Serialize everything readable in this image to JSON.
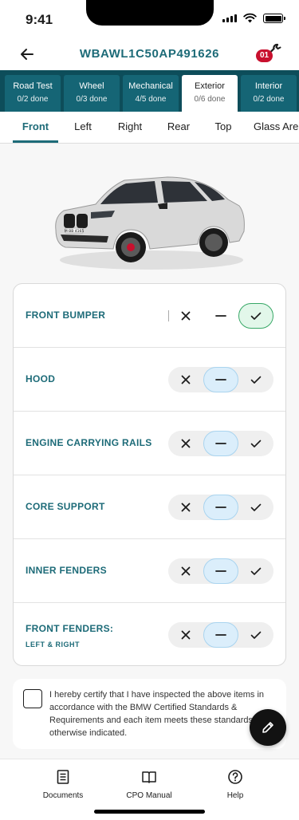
{
  "status_bar": {
    "time": "9:41"
  },
  "header": {
    "title": "WBAWL1C50AP491626",
    "badge_count": "01",
    "back_icon": "arrow-left-icon",
    "tool_icon": "wrench-icon"
  },
  "category_tabs": [
    {
      "name": "Road Test",
      "count": "0/2 done",
      "active": false
    },
    {
      "name": "Wheel",
      "count": "0/3 done",
      "active": false
    },
    {
      "name": "Mechanical",
      "count": "4/5 done",
      "active": false
    },
    {
      "name": "Exterior",
      "count": "0/6 done",
      "active": true
    },
    {
      "name": "Interior",
      "count": "0/2 done",
      "active": false
    }
  ],
  "sub_tabs": [
    {
      "label": "Front",
      "active": true
    },
    {
      "label": "Left",
      "active": false
    },
    {
      "label": "Right",
      "active": false
    },
    {
      "label": "Rear",
      "active": false
    },
    {
      "label": "Top",
      "active": false
    },
    {
      "label": "Glass Area",
      "active": false
    }
  ],
  "vehicle_image": {
    "plate_text": "M BB 4165",
    "color": "#d9d9d9"
  },
  "inspection_items": [
    {
      "label": "FRONT BUMPER",
      "sublabel": "",
      "selected": "pass"
    },
    {
      "label": "HOOD",
      "sublabel": "",
      "selected": "na"
    },
    {
      "label": "ENGINE CARRYING RAILS",
      "sublabel": "",
      "selected": "na"
    },
    {
      "label": "CORE SUPPORT",
      "sublabel": "",
      "selected": "na"
    },
    {
      "label": "INNER FENDERS",
      "sublabel": "",
      "selected": "na"
    },
    {
      "label": "FRONT FENDERS:",
      "sublabel": "LEFT & RIGHT",
      "selected": "na"
    }
  ],
  "certification": {
    "text": "I hereby certify that I have inspected the above items in accordance with the BMW Certified Standards & Requirements and each item meets these standards unless otherwise indicated.",
    "checked": false
  },
  "bottom_nav": [
    {
      "label": "Documents",
      "icon": "document-icon"
    },
    {
      "label": "CPO Manual",
      "icon": "book-icon"
    },
    {
      "label": "Help",
      "icon": "help-circle-icon"
    }
  ],
  "colors": {
    "accent": "#1d6b78",
    "tab_bar": "#0d4d5a",
    "tab_inactive": "#156575",
    "badge": "#c8102e",
    "pass_border": "#38a867",
    "na_fill": "#dbeefb"
  }
}
